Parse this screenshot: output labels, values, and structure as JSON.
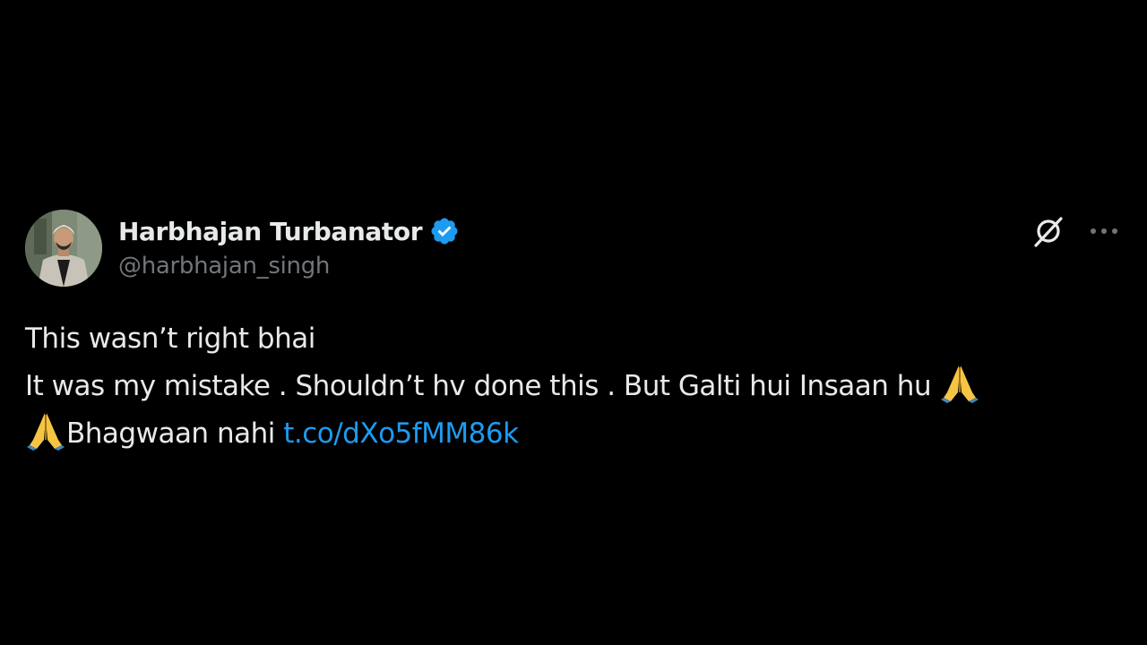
{
  "author": {
    "display_name": "Harbhajan Turbanator",
    "handle": "@harbhajan_singh",
    "verified": true,
    "verified_color": "#1d9bf0"
  },
  "tweet": {
    "line1": "This wasn’t right bhai",
    "line2_text": "It was my mistake . Shouldn’t hv done this . But Galti hui Insaan hu ",
    "line3_text": "Bhagwaan nahi ",
    "link": "t.co/dXo5fMM86k",
    "emoji": "folded-hands-emoji"
  },
  "actions": {
    "grok_icon": "grok-icon",
    "more_icon": "more-icon"
  },
  "colors": {
    "background": "#000000",
    "text": "#e7e9ea",
    "secondary_text": "#71767b",
    "link": "#1d9bf0"
  }
}
